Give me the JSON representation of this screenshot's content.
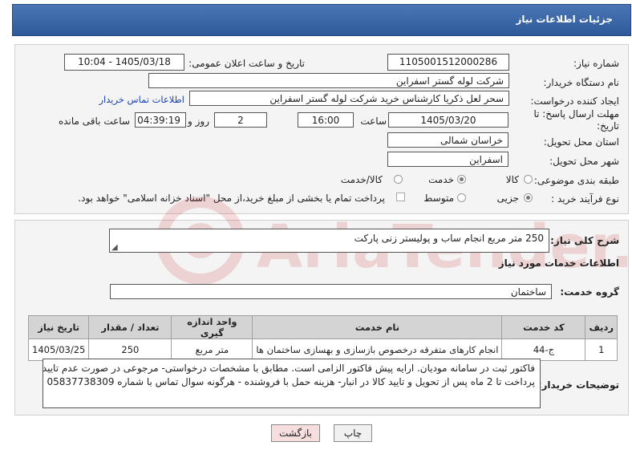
{
  "header": {
    "title": "جزئیات اطلاعات نیاز"
  },
  "form": {
    "need_number_label": "شماره نیاز:",
    "need_number": "1105001512000286",
    "announce_label": "تاریخ و ساعت اعلان عمومی:",
    "announce_value": "1405/03/18 - 10:04",
    "buyer_org_label": "نام دستگاه خریدار:",
    "buyer_org": "شرکت لوله گستر اسفراین",
    "requester_label": "ایجاد کننده درخواست:",
    "requester": "سحر لعل ذکریا کارشناس خرید شرکت لوله گستر اسفراین",
    "contact_link": "اطلاعات تماس خریدار",
    "deadline_label_line1": "مهلت ارسال پاسخ: تا",
    "deadline_label_line2": "تاریخ:",
    "deadline_date": "1405/03/20",
    "time_label": "ساعت",
    "deadline_time": "16:00",
    "days_value": "2",
    "days_label": "روز و",
    "remaining_time": "04:39:19",
    "remaining_label": "ساعت باقی مانده",
    "province_label": "استان محل تحویل:",
    "province": "خراسان شمالی",
    "city_label": "شهر محل تحویل:",
    "city": "اسفراین",
    "category_label": "طبقه بندی موضوعی:",
    "category_options": [
      "کالا",
      "خدمت",
      "کالا/خدمت"
    ],
    "category_selected": "خدمت",
    "process_label": "نوع فرآیند خرید :",
    "process_options": [
      "جزیی",
      "متوسط"
    ],
    "process_selected": "جزیی",
    "treasury_note": "پرداخت تمام یا بخشی از مبلغ خرید،از محل \"اسناد خزانه اسلامی\" خواهد بود."
  },
  "summary": {
    "label": "شرح کلی نیاز:",
    "value": "250 متر مربع انجام ساب و پولیستر زنی پارکت"
  },
  "services": {
    "section_title": "اطلاعات خدمات مورد نیاز",
    "group_label": "گروه خدمت:",
    "group_value": "ساختمان",
    "columns": [
      "ردیف",
      "کد خدمت",
      "نام خدمت",
      "واحد اندازه گیری",
      "تعداد / مقدار",
      "تاریخ نیاز"
    ],
    "rows": [
      {
        "row": "1",
        "code": "ج-44",
        "name": "انجام کارهای متفرقه درخصوص بازسازی و بهسازی ساختمان ها",
        "unit": "متر مربع",
        "qty": "250",
        "date": "1405/03/25"
      }
    ]
  },
  "buyer_notes": {
    "label": "توضیحات خریدار:",
    "line1": "فاکتور ثبت در سامانه مودیان. ارایه پیش فاکتور الزامی است. مطابق با مشخصات درخواستی- مرجوعی در صورت عدم تایید -",
    "line2": "پرداخت تا 2 ماه پس از تحویل و تایید کالا در انبار- هزینه حمل با فروشنده - هرگونه سوال تماس با شماره 05837738309"
  },
  "buttons": {
    "print": "چاپ",
    "back": "بازگشت"
  },
  "watermark": {
    "text": "AriaTender.net"
  },
  "colors": {
    "header": "#2f5a9a",
    "link": "#1a44b8",
    "back_button": "#f6dede",
    "watermark": "#c62828"
  }
}
